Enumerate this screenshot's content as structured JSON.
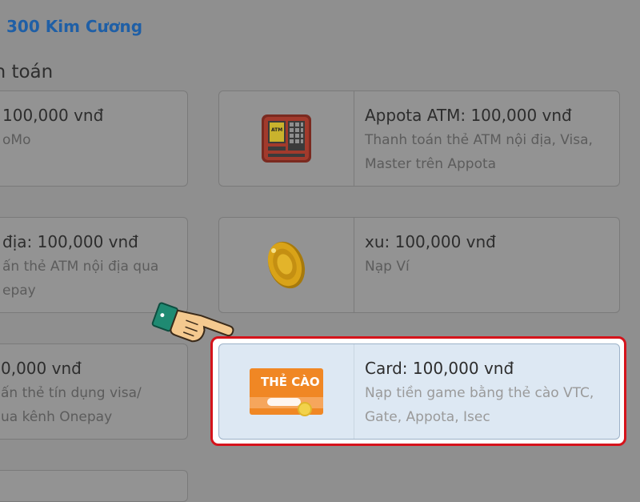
{
  "package": {
    "title": "300 Kim Cương"
  },
  "section": {
    "title": "nh toán"
  },
  "left_options": [
    {
      "amount": "100,000 vnđ",
      "description": [
        "oMo"
      ]
    },
    {
      "amount": "địa: 100,000 vnđ",
      "description": [
        "ấn thẻ ATM nội địa qua",
        "epay"
      ]
    },
    {
      "amount": "0,000 vnđ",
      "description": [
        "ấn thẻ tín dụng visa/",
        "ua kênh Onepay"
      ]
    }
  ],
  "right_options": [
    {
      "icon": "atm-icon",
      "amount": "Appota ATM: 100,000 vnđ",
      "description": [
        "Thanh toán thẻ ATM nội địa, Visa,",
        "Master trên Appota"
      ]
    },
    {
      "icon": "coin-icon",
      "amount": "xu: 100,000 vnđ",
      "description": [
        "Nạp Ví"
      ]
    },
    {
      "icon": "scratch-card-icon",
      "icon_text": "THẺ CÀO",
      "amount": "Card: 100,000 vnđ",
      "description": [
        "Nạp tiền game bằng thẻ cào VTC,",
        "Gate, Appota, Isec"
      ],
      "selected": true
    }
  ],
  "colors": {
    "accent": "#1f5fa6",
    "highlight_border": "#d5131b",
    "selected_bg": "#dde8f3",
    "card_orange": "#f08724"
  }
}
